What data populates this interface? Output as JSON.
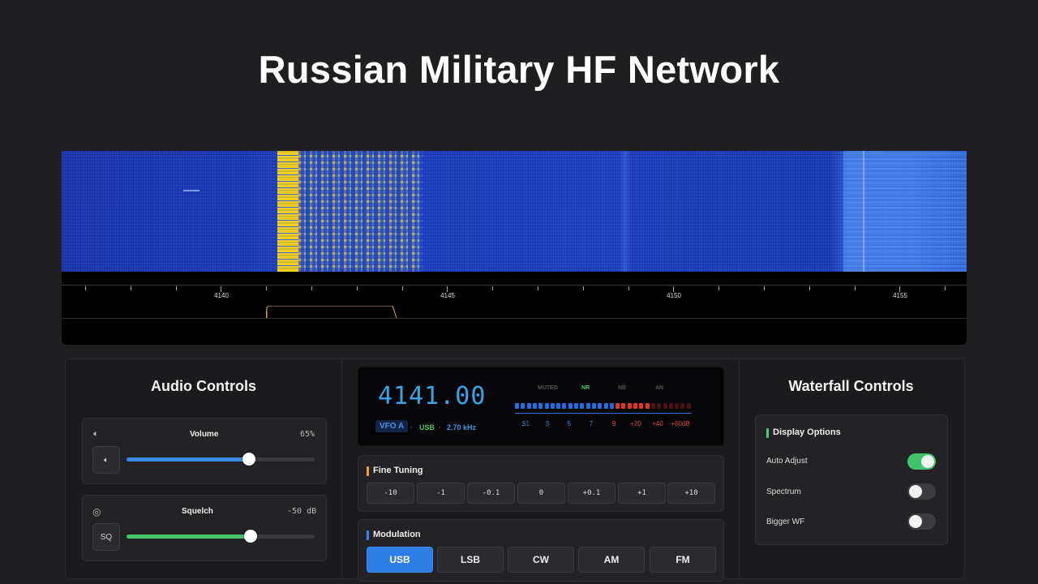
{
  "title": "Russian Military HF Network",
  "waterfall": {
    "scale_labels": [
      "4140",
      "4145",
      "4150",
      "4155"
    ]
  },
  "audio": {
    "heading": "Audio Controls",
    "volume": {
      "label": "Volume",
      "value_text": "65%",
      "level": 0.65,
      "icon": "speaker-icon"
    },
    "squelch": {
      "label": "Squelch",
      "value_text": "-50 dB",
      "level": 0.66,
      "button_label": "SQ",
      "icon": "target-icon"
    }
  },
  "vfo": {
    "frequency": "4141.00",
    "vfo_label": "VFO A",
    "mode": "USB",
    "bandwidth": "2.70 kHz",
    "separator": "·",
    "flags": {
      "muted": "MUTED",
      "nr": "NR",
      "nb": "NB",
      "an": "AN"
    },
    "meter_labels": [
      "S1",
      "3",
      "5",
      "7",
      "9",
      "+20",
      "+40",
      "+60dB"
    ],
    "colors": {
      "blue": "#1f6fe0",
      "red": "#e0342f",
      "dim_red": "#4a1212"
    }
  },
  "fine_tuning": {
    "title": "Fine Tuning",
    "buttons": [
      "-10",
      "-1",
      "-0.1",
      "0",
      "+0.1",
      "+1",
      "+10"
    ]
  },
  "modulation": {
    "title": "Modulation",
    "buttons": [
      "USB",
      "LSB",
      "CW",
      "AM",
      "FM"
    ],
    "selected": "USB"
  },
  "waterfall_controls": {
    "heading": "Waterfall Controls",
    "section_title": "Display Options",
    "options": [
      {
        "label": "Auto Adjust",
        "on": true
      },
      {
        "label": "Spectrum",
        "on": false
      },
      {
        "label": "Bigger WF",
        "on": false
      }
    ]
  }
}
